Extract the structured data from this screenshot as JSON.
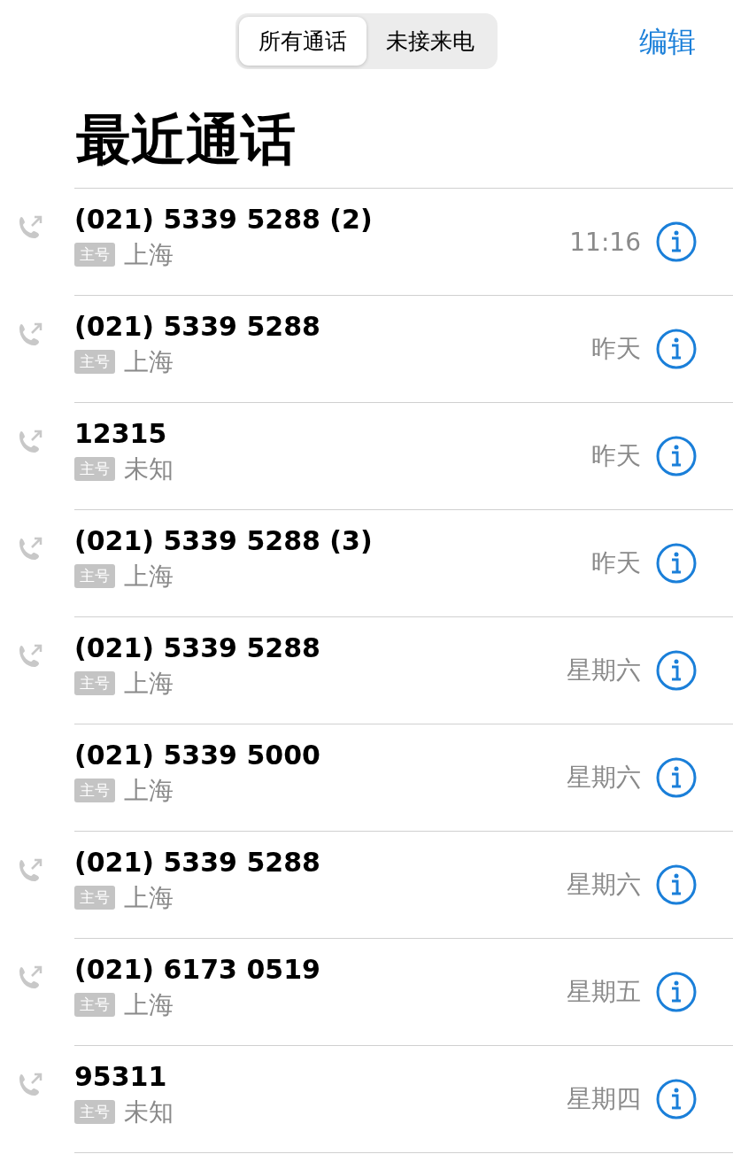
{
  "segments": [
    {
      "label": "所有通话",
      "selected": true
    },
    {
      "label": "未接来电",
      "selected": false
    }
  ],
  "edit_button": "编辑",
  "title": "最近通话",
  "calls": [
    {
      "number": "(021) 5339 5288 (2)",
      "tag": "主号",
      "location": "上海",
      "time": "11:16",
      "outgoing": true
    },
    {
      "number": "(021) 5339 5288",
      "tag": "主号",
      "location": "上海",
      "time": "昨天",
      "outgoing": true
    },
    {
      "number": "12315",
      "tag": "主号",
      "location": "未知",
      "time": "昨天",
      "outgoing": true
    },
    {
      "number": "(021) 5339 5288 (3)",
      "tag": "主号",
      "location": "上海",
      "time": "昨天",
      "outgoing": true
    },
    {
      "number": "(021) 5339 5288",
      "tag": "主号",
      "location": "上海",
      "time": "星期六",
      "outgoing": true
    },
    {
      "number": "(021) 5339 5000",
      "tag": "主号",
      "location": "上海",
      "time": "星期六",
      "outgoing": false
    },
    {
      "number": "(021) 5339 5288",
      "tag": "主号",
      "location": "上海",
      "time": "星期六",
      "outgoing": true
    },
    {
      "number": "(021) 6173 0519",
      "tag": "主号",
      "location": "上海",
      "time": "星期五",
      "outgoing": true
    },
    {
      "number": "95311",
      "tag": "主号",
      "location": "未知",
      "time": "星期四",
      "outgoing": true
    }
  ]
}
